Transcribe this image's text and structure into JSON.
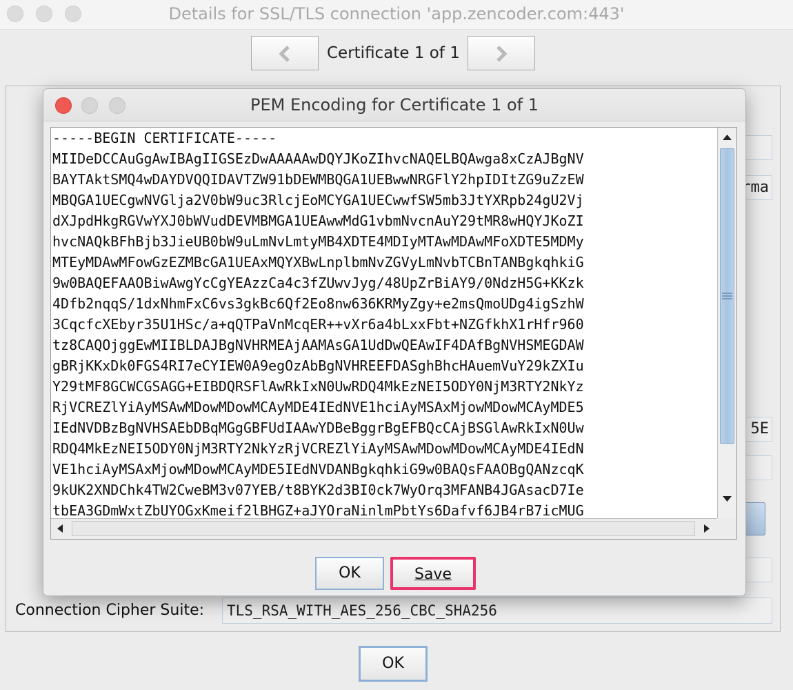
{
  "outer_window": {
    "title": "Details for SSL/TLS connection 'app.zencoder.com:443'",
    "certificate_nav": "Certificate 1 of 1",
    "peek_text_1": "rma",
    "peek_text_2": "5E",
    "cipher_label": "Connection Cipher Suite:",
    "cipher_value": "TLS_RSA_WITH_AES_256_CBC_SHA256",
    "ok_label": "OK"
  },
  "dialog": {
    "title": "PEM Encoding for Certificate 1 of 1",
    "pem_lines": [
      "-----BEGIN CERTIFICATE-----",
      "MIIDeDCCAuGgAwIBAgIIGSEzDwAAAAAwDQYJKoZIhvcNAQELBQAwga8xCzAJBgNV",
      "BAYTAktSMQ4wDAYDVQQIDAVTZW91bDEWMBQGA1UEBwwNRGFlY2hpIDItZG9uZzEW",
      "MBQGA1UECgwNVGlja2V0bW9uc3RlcjEoMCYGA1UECwwfSW5mb3JtYXRpb24gU2Vj",
      "dXJpdHkgRGVwYXJ0bWVudDEVMBMGA1UEAwwMdG1vbmNvcnAuY29tMR8wHQYJKoZI",
      "hvcNAQkBFhBjb3JieUB0bW9uLmNvLmtyMB4XDTE4MDIyMTAwMDAwMFoXDTE5MDMy",
      "MTEyMDAwMFowGzEZMBcGA1UEAxMQYXBwLnplbmNvZGVyLmNvbTCBnTANBgkqhkiG",
      "9w0BAQEFAAOBiwAwgYcCgYEAzzCa4c3fZUwvJyg/48UpZrBiAY9/0NdzH5G+KKzk",
      "4Dfb2nqqS/1dxNhmFxC6vs3gkBc6Qf2Eo8nw636KRMyZgy+e2msQmoUDg4igSzhW",
      "3CqcfcXEbyr35U1HSc/a+qQTPaVnMcqER++vXr6a4bLxxFbt+NZGfkhX1rHfr960",
      "tz8CAQOjggEwMIIBLDAJBgNVHRMEAjAAMAsGA1UdDwQEAwIF4DAfBgNVHSMEGDAW",
      "gBRjKKxDk0FGS4RI7eCYIEW0A9egOzAbBgNVHREEFDASghBhcHAuemVuY29kZXIu",
      "Y29tMF8GCWCGSAGG+EIBDQRSFlAwRkIxN0UwRDQ4MkEzNEI5ODY0NjM3RTY2NkYz",
      "RjVCREZlYiAyMSAwMDowMDowMCAyMDE4IEdNVE1hciAyMSAxMjowMDowMCAyMDE5",
      "IEdNVDBzBgNVHSAEbDBqMGgGBFUdIAAwYDBeBggrBgEFBQcCAjBSGlAwRkIxN0Uw",
      "RDQ4MkEzNEI5ODY0NjM3RTY2NkYzRjVCREZlYiAyMSAwMDowMDowMCAyMDE4IEdN",
      "VE1hciAyMSAxMjowMDowMCAyMDE5IEdNVDANBgkqhkiG9w0BAQsFAAOBgQANzcqK",
      "9kUK2XNDChk4TW2CweBM3v07YEB/t8BYK2d3BI0ck7WyOrq3MFANB4JGAsacD7Ie",
      "tbEA3GDmWxtZbUYOGxKmeif2lBHGZ+aJYOraNinlmPbtYs6Dafvf6JB4rB7icMUG"
    ],
    "ok_label": "OK",
    "save_label": "Save"
  },
  "colors": {
    "close_red": "#ee5a52",
    "inactive_light": "#d6d6d6",
    "save_highlight": "#e8336b",
    "scroll_thumb": "#b0c9e4"
  }
}
